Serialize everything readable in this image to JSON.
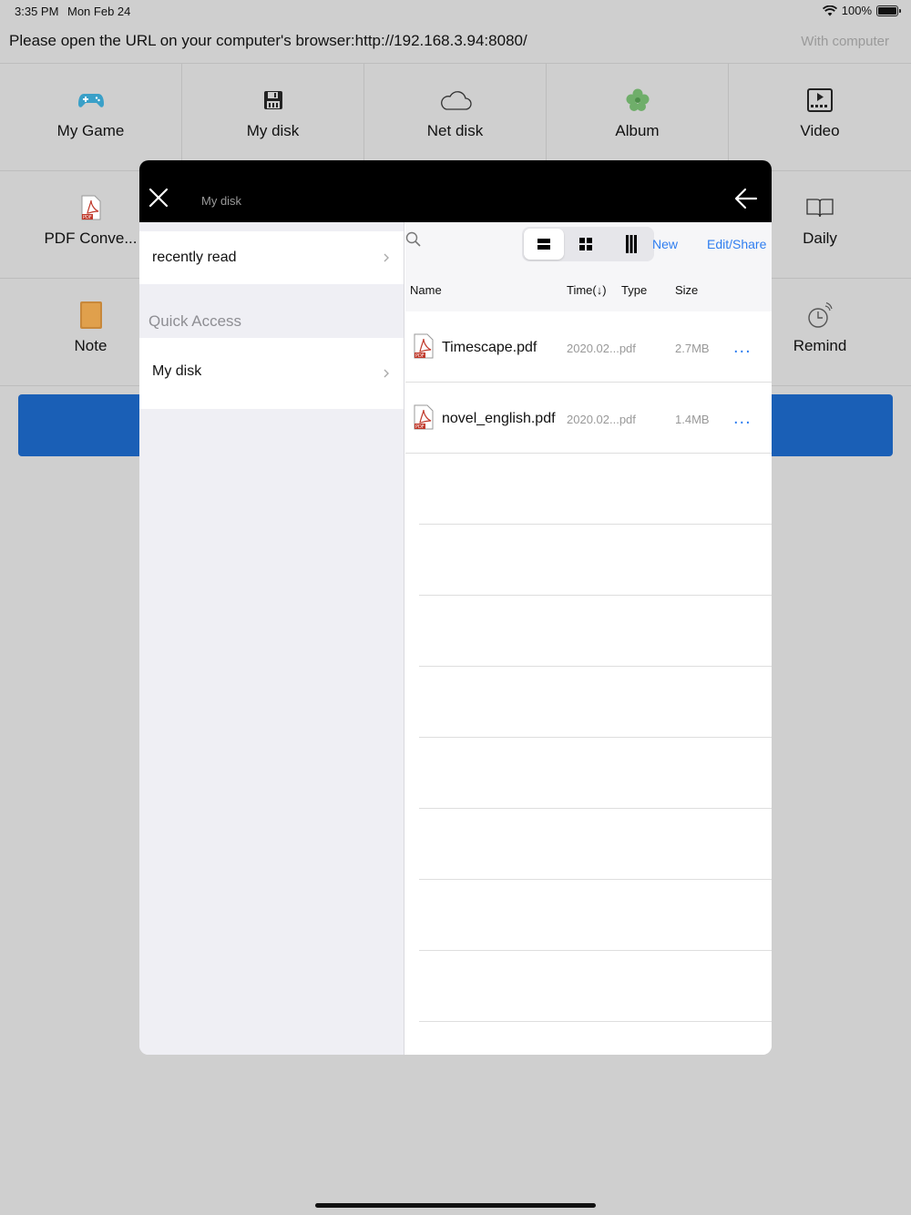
{
  "status_bar": {
    "time": "3:35 PM",
    "date": "Mon Feb 24",
    "battery": "100%"
  },
  "url_bar": {
    "message": "Please open the URL on your computer's browser:http://192.168.3.94:8080/",
    "with_computer": "With computer"
  },
  "grid": {
    "items": [
      {
        "label": "My Game",
        "icon": "gamepad-icon"
      },
      {
        "label": "My disk",
        "icon": "floppy-disk-icon"
      },
      {
        "label": "Net disk",
        "icon": "cloud-icon"
      },
      {
        "label": "Album",
        "icon": "flower-icon"
      },
      {
        "label": "Video",
        "icon": "video-icon"
      },
      {
        "label": "PDF Conve...",
        "icon": "pdf-icon"
      },
      {
        "label": "Daily",
        "icon": "book-icon"
      },
      {
        "label": "Note",
        "icon": "notebook-icon"
      },
      {
        "label": "Remind",
        "icon": "clock-alarm-icon"
      }
    ]
  },
  "modal": {
    "title": "My disk",
    "sidebar": {
      "recently_read": "recently read",
      "section": "Quick Access",
      "my_disk": "My disk"
    },
    "toolbar": {
      "new_label": "New",
      "edit_share_label": "Edit/Share"
    },
    "columns": {
      "name": "Name",
      "time": "Time(↓)",
      "type": "Type",
      "size": "Size"
    },
    "files": [
      {
        "name": "Timescape.pdf",
        "time_type": "2020.02...pdf",
        "size": "2.7MB",
        "more": "..."
      },
      {
        "name": "novel_english.pdf",
        "time_type": "2020.02...pdf",
        "size": "1.4MB",
        "more": "..."
      }
    ]
  },
  "colors": {
    "accent": "#2f7ef0",
    "blue_bar": "#1a5fb6",
    "header": "#000000"
  }
}
